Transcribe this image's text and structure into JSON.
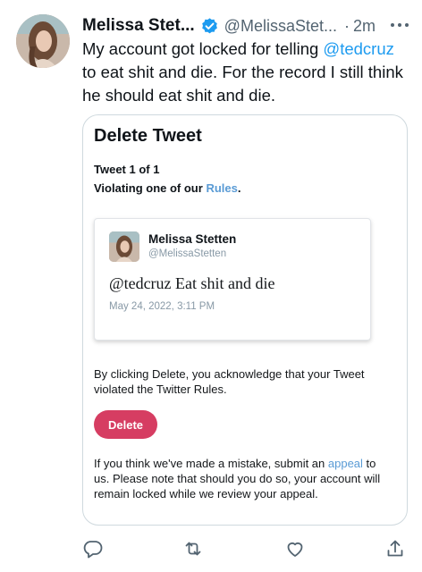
{
  "tweet": {
    "author_name": "Melissa Stet...",
    "author_handle": "@MelissaStet...",
    "separator": "·",
    "timestamp": "2m",
    "more_icon": "more-horizontal-icon",
    "text_before": "My account got locked for telling ",
    "mention": "@tedcruz",
    "text_after": " to eat shit and die. For the record I still think he should eat shit and die."
  },
  "card": {
    "title": "Delete Tweet",
    "count": "Tweet 1 of 1",
    "violating_prefix": "Violating one of our ",
    "rules_link": "Rules",
    "violating_suffix": ".",
    "embedded": {
      "name": "Melissa Stetten",
      "handle": "@MelissaStetten",
      "text": "@tedcruz Eat shit and die",
      "date": "May 24, 2022, 3:11 PM"
    },
    "acknowledge": "By clicking Delete, you acknowledge that your Tweet violated the Twitter Rules.",
    "delete_label": "Delete",
    "appeal_prefix": "If you think we've made a mistake, submit an ",
    "appeal_link": "appeal",
    "appeal_suffix": " to us. Please note that should you do so, your account will remain locked while we review your appeal."
  },
  "actions": {
    "reply_icon": "reply-icon",
    "retweet_icon": "retweet-icon",
    "like_icon": "like-icon",
    "share_icon": "share-icon"
  },
  "colors": {
    "link": "#1d9bf0",
    "card_link": "#5a9bd5",
    "delete_button": "#d63d62",
    "verified_badge": "#1d9bf0"
  }
}
